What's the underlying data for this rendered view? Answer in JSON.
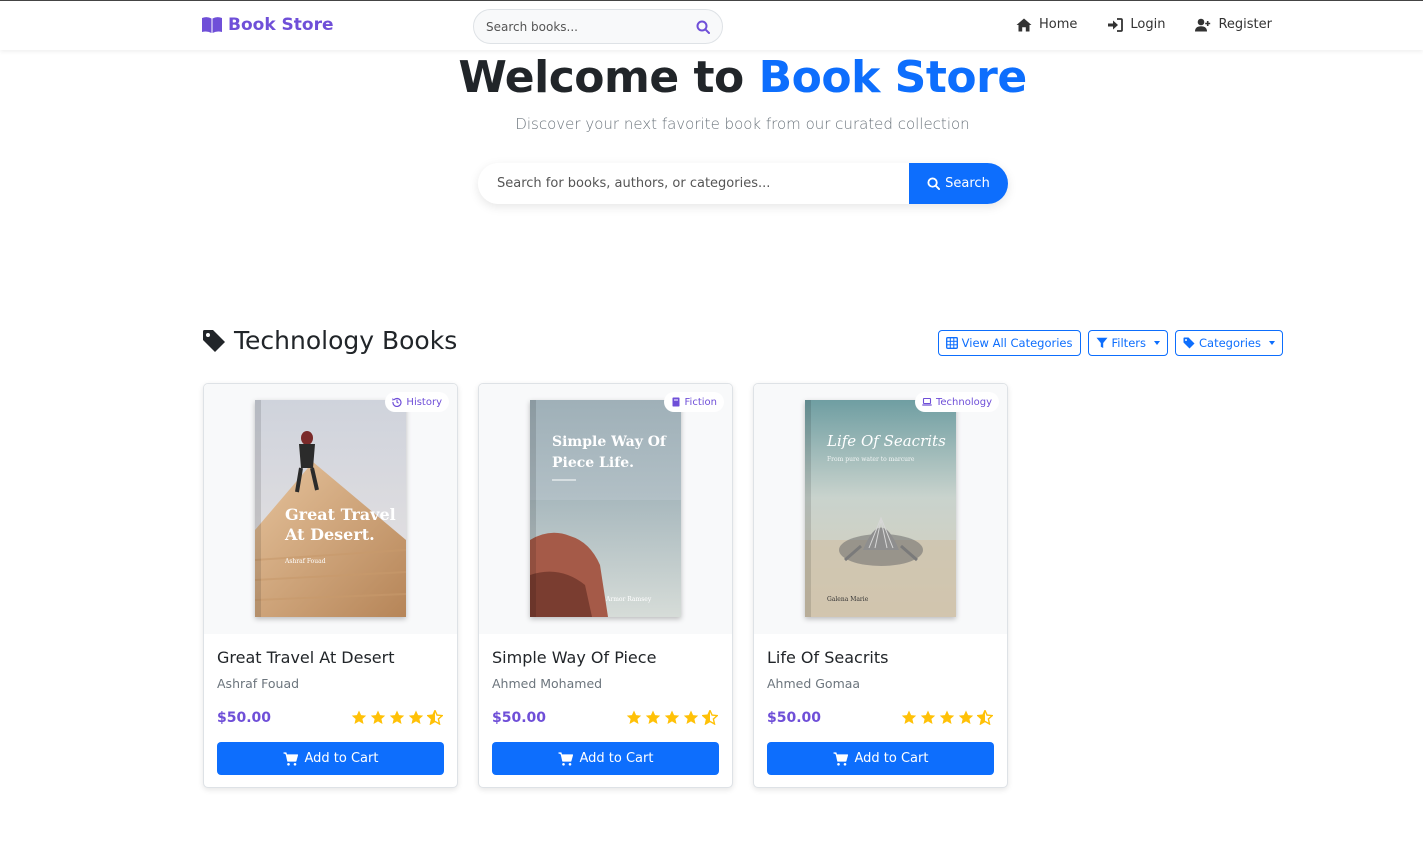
{
  "brand": {
    "name": "Book Store"
  },
  "nav": {
    "search_placeholder": "Search books...",
    "links": [
      {
        "label": "Home"
      },
      {
        "label": "Login"
      },
      {
        "label": "Register"
      }
    ]
  },
  "hero": {
    "title_prefix": "Welcome to",
    "title_accent": "Book Store",
    "subtitle": "Discover your next favorite book from our curated collection",
    "search_placeholder": "Search for books, authors, or categories...",
    "search_button": "Search"
  },
  "section": {
    "title": "Technology Books",
    "actions": {
      "view_all": "View All Categories",
      "filters": "Filters",
      "categories": "Categories"
    }
  },
  "colors": {
    "brand": "#6f4fd8",
    "primary": "#0d6efd",
    "star": "#ffc107"
  },
  "books": [
    {
      "category": "History",
      "category_icon": "history-icon",
      "title": "Great Travel At Desert",
      "author": "Ashraf Fouad",
      "price": "$50.00",
      "rating": 4.5,
      "cover_title": "Great Travel At Desert.",
      "cover_author": "Ashraf Fouad",
      "button": "Add to Cart"
    },
    {
      "category": "Fiction",
      "category_icon": "book-icon",
      "title": "Simple Way Of Piece",
      "author": "Ahmed Mohamed",
      "price": "$50.00",
      "rating": 4.5,
      "cover_title": "Simple Way Of Piece Life.",
      "cover_author": "Armor Ramsey",
      "button": "Add to Cart"
    },
    {
      "category": "Technology",
      "category_icon": "laptop-icon",
      "title": "Life Of Seacrits",
      "author": "Ahmed Gomaa",
      "price": "$50.00",
      "rating": 4.5,
      "cover_title": "Life Of Seacrits",
      "cover_subtitle": "From pure water to marcure",
      "cover_author": "Galena Marie",
      "button": "Add to Cart"
    }
  ]
}
